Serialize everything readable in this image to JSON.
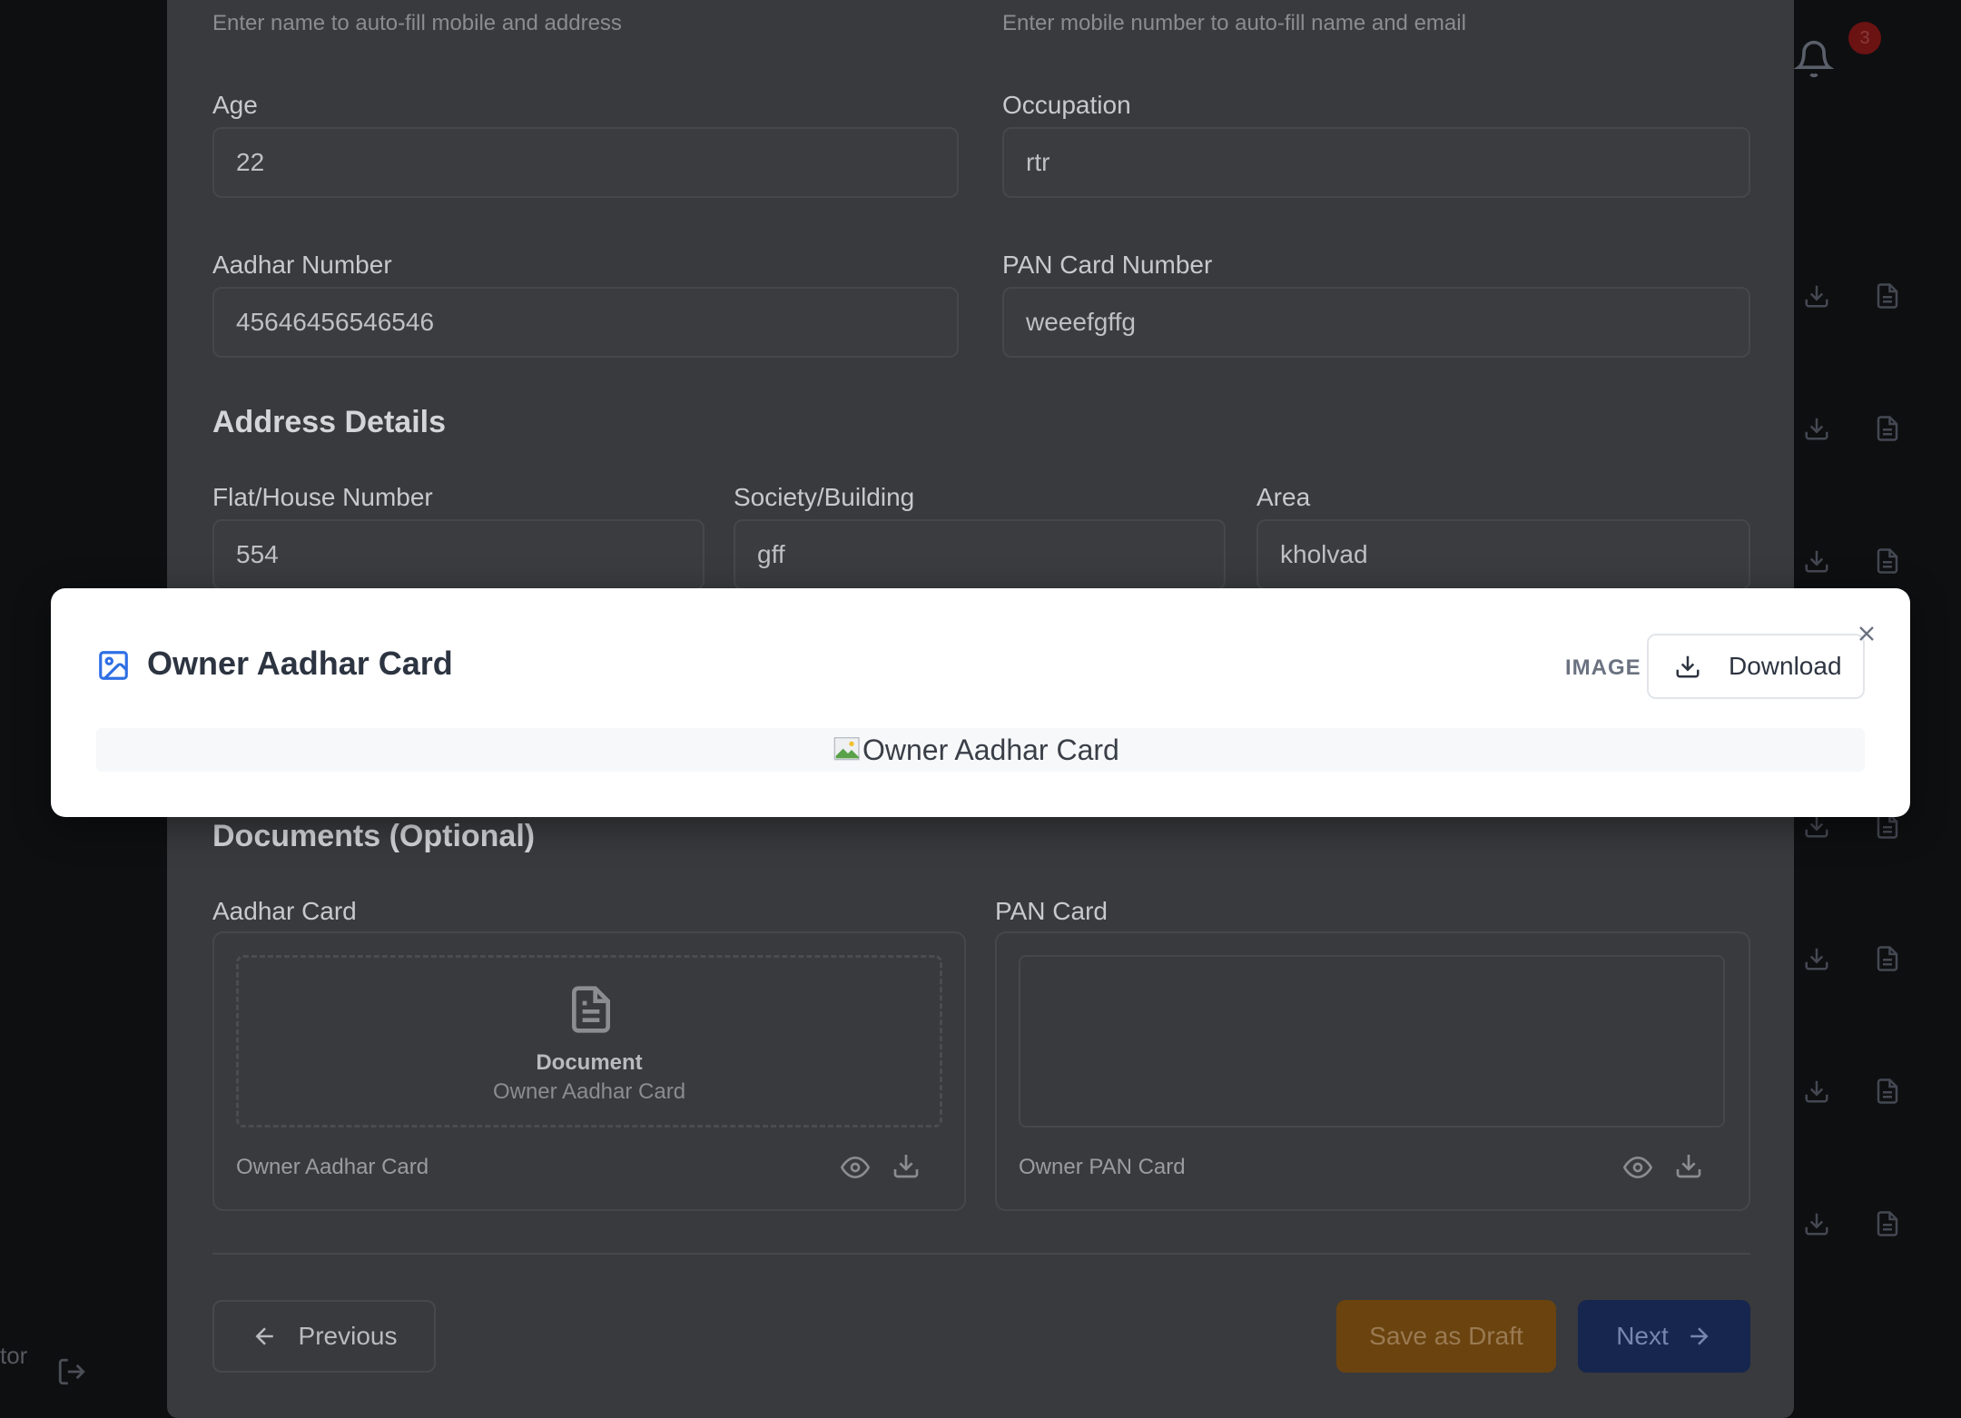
{
  "background": {
    "notification_count": "3",
    "left_fragment": "tor"
  },
  "form": {
    "hints": {
      "name": "Enter name to auto-fill mobile and address",
      "mobile": "Enter mobile number to auto-fill name and email"
    },
    "age": {
      "label": "Age",
      "value": "22"
    },
    "occupation": {
      "label": "Occupation",
      "value": "rtr"
    },
    "aadhar": {
      "label": "Aadhar Number",
      "value": "45646456546546"
    },
    "pan": {
      "label": "PAN Card Number",
      "value": "weeefgffg"
    },
    "address_section": "Address Details",
    "flat": {
      "label": "Flat/House Number",
      "value": "554"
    },
    "society": {
      "label": "Society/Building",
      "value": "gff"
    },
    "area": {
      "label": "Area",
      "value": "kholvad"
    },
    "documents_section": "Documents (Optional)",
    "aadhar_card": {
      "label": "Aadhar Card",
      "preview_title": "Document",
      "preview_sub": "Owner Aadhar Card",
      "file_name": "Owner Aadhar Card"
    },
    "pan_card": {
      "label": "PAN Card",
      "file_name": "Owner PAN Card"
    },
    "buttons": {
      "previous": "Previous",
      "save_draft": "Save as Draft",
      "next": "Next"
    }
  },
  "modal": {
    "title": "Owner Aadhar Card",
    "type_label": "IMAGE",
    "download": "Download",
    "image_alt": "Owner Aadhar Card"
  },
  "colors": {
    "accent_blue": "#2f6fe4",
    "draft_orange": "#6a430f",
    "next_navy": "#16264f"
  }
}
